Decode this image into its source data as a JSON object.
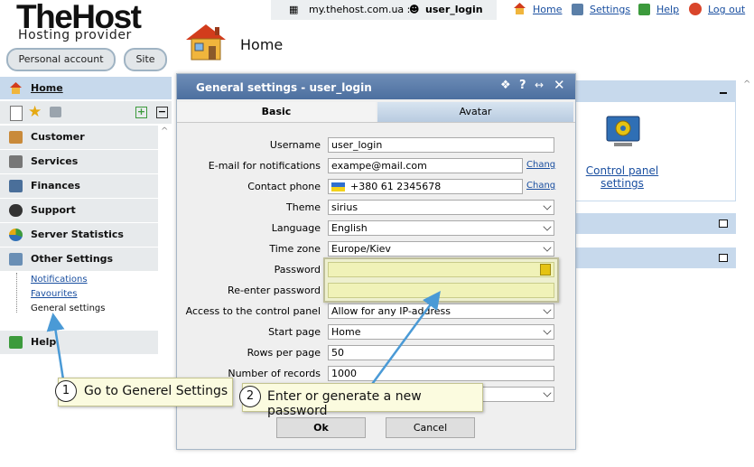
{
  "logo": {
    "main": "TheHost",
    "sub": "Hosting provider"
  },
  "header_buttons": {
    "personal_account": "Personal account",
    "site": "Site"
  },
  "topbar": {
    "domain": "my.thehost.com.ua ::",
    "user": "user_login"
  },
  "toplinks": [
    {
      "label": "Home",
      "icon": "home-icon"
    },
    {
      "label": "Settings",
      "icon": "settings-icon"
    },
    {
      "label": "Help",
      "icon": "help-icon"
    },
    {
      "label": "Log out",
      "icon": "logout-icon"
    }
  ],
  "page_title": "Home",
  "sidebar": {
    "home": "Home",
    "items": [
      {
        "label": "Customer",
        "icon": "customer-icon"
      },
      {
        "label": "Services",
        "icon": "cart-icon"
      },
      {
        "label": "Finances",
        "icon": "finances-icon"
      },
      {
        "label": "Support",
        "icon": "headset-icon"
      },
      {
        "label": "Server Statistics",
        "icon": "pie-chart-icon"
      },
      {
        "label": "Other Settings",
        "icon": "gear-icon"
      }
    ],
    "sub_items": [
      "Notifications",
      "Favourites",
      "General settings"
    ],
    "help": "Help"
  },
  "right_panel": {
    "control_panel_settings": "Control panel settings"
  },
  "dialog": {
    "title": "General settings - user_login",
    "tabs": [
      "Basic",
      "Avatar"
    ],
    "labels": {
      "username": "Username",
      "email": "E-mail for notifications",
      "phone": "Contact phone",
      "theme": "Theme",
      "language": "Language",
      "timezone": "Time zone",
      "password": "Password",
      "repassword": "Re-enter password",
      "access": "Access to the control panel",
      "startpage": "Start page",
      "rows": "Rows per page",
      "records": "Number of records"
    },
    "values": {
      "username": "user_login",
      "email": "exampe@mail.com",
      "phone": "+380 61 2345678",
      "theme": "sirius",
      "language": "English",
      "timezone": "Europe/Kiev",
      "password": "",
      "repassword": "",
      "access": "Allow for any IP-address",
      "startpage": "Home",
      "rows": "50",
      "records": "1000"
    },
    "change_link": "Chang",
    "ok": "Ok",
    "cancel": "Cancel"
  },
  "callouts": [
    {
      "num": "1",
      "text": "Go to Generel Settings"
    },
    {
      "num": "2",
      "text": "Enter or generate a new password"
    }
  ],
  "colors": {
    "accent": "#4c6f9f",
    "nav_active": "#c7d9ec",
    "password_field": "#f0f2b8"
  }
}
